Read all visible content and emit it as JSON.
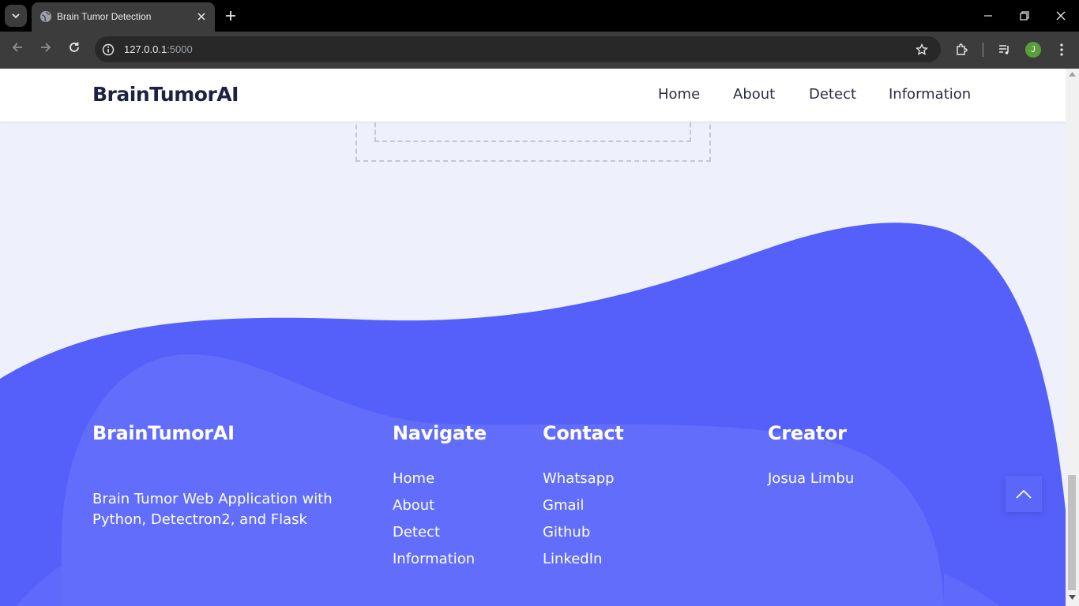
{
  "browser": {
    "tab_title": "Brain Tumor Detection",
    "url_host": "127.0.0.1",
    "url_port": ":5000",
    "profile_initial": "J"
  },
  "navbar": {
    "brand": "BrainTumorAI",
    "links": [
      "Home",
      "About",
      "Detect",
      "Information"
    ]
  },
  "footer": {
    "brand": "BrainTumorAI",
    "description_line1": "Brain Tumor Web Application with",
    "description_line2": "Python, Detectron2, and Flask",
    "navigate": {
      "title": "Navigate",
      "links": [
        "Home",
        "About",
        "Detect",
        "Information"
      ]
    },
    "contact": {
      "title": "Contact",
      "links": [
        "Whatsapp",
        "Gmail",
        "Github",
        "LinkedIn"
      ]
    },
    "creator": {
      "title": "Creator",
      "name": "Josua Limbu"
    }
  },
  "colors": {
    "accent": "#5560fa",
    "page_bg": "#eef0fb",
    "nav_text": "#1d2144"
  }
}
